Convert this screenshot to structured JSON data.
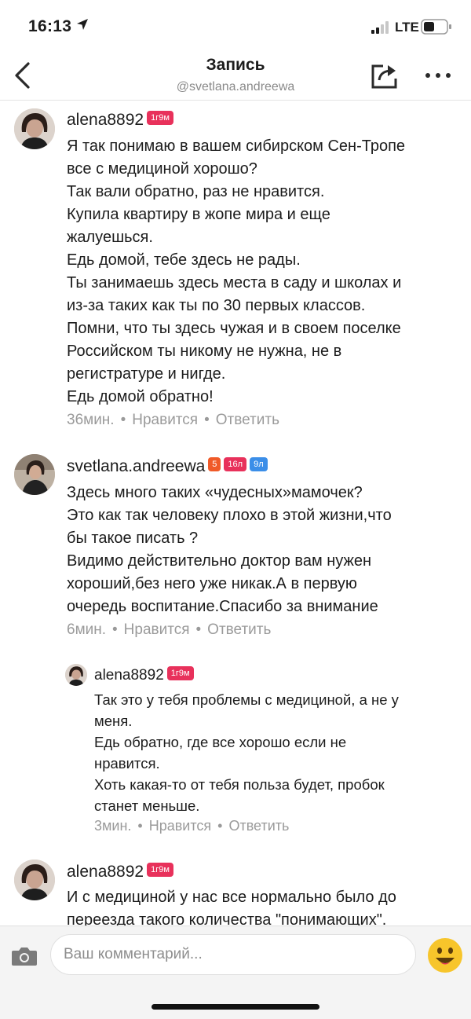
{
  "status_bar": {
    "time": "16:13",
    "network": "LTE"
  },
  "nav": {
    "title": "Запись",
    "subtitle": "@svetlana.andreewa"
  },
  "comments": [
    {
      "username": "alena8892",
      "badges": [
        "1г9м"
      ],
      "lines": [
        "Я так понимаю в вашем сибирском Сен-Тропе",
        "все с медициной хорошо?",
        "Так вали обратно, раз не нравится.",
        "Купила квартиру в жопе мира и еще",
        "жалуешься.",
        "Едь домой, тебе здесь не рады.",
        "Ты занимаешь здесь места в саду и школах и",
        "из-за таких как ты по 30 первых классов.",
        "Помни, что ты здесь чужая и в своем поселке",
        "Российском ты никому не нужна, не в",
        "регистратуре и нигде.",
        "Едь домой обратно!"
      ],
      "time": "36мин.",
      "like_label": "Нравится",
      "reply_label": "Ответить"
    },
    {
      "username": "svetlana.andreewa",
      "badges": [
        "5",
        "16л",
        "9л"
      ],
      "lines": [
        "Здесь много таких «чудесных»мамочек?",
        "Это как так человеку плохо в этой жизни,что",
        "бы такое писать ?",
        "Видимо действительно доктор вам нужен",
        "хороший,без него уже никак.А в первую",
        "очередь воспитание.Спасибо за внимание"
      ],
      "time": "6мин.",
      "like_label": "Нравится",
      "reply_label": "Ответить"
    },
    {
      "username": "alena8892",
      "badges": [
        "1г9м"
      ],
      "lines": [
        "Так это у тебя проблемы с медициной, а не у",
        "меня.",
        "Едь обратно, где все хорошо если не",
        "нравится.",
        "Хоть какая-то от тебя польза будет, пробок",
        "станет меньше."
      ],
      "time": "3мин.",
      "like_label": "Нравится",
      "reply_label": "Ответить"
    },
    {
      "username": "alena8892",
      "badges": [
        "1г9м"
      ],
      "lines": [
        "И с медициной у нас все нормально было до",
        "переезда такого количества \"понимающих\"."
      ]
    }
  ],
  "input": {
    "placeholder": "Ваш комментарий..."
  },
  "colors": {
    "badge_red": "#e8315b",
    "badge_orange": "#f05a28",
    "badge_blue": "#3b8ee8",
    "emoji_yellow": "#f7c52b"
  },
  "icons": [
    "back-chevron-icon",
    "share-icon",
    "more-icon",
    "camera-icon",
    "smiley-emoji-icon",
    "location-arrow-icon",
    "signal-icon",
    "battery-icon"
  ]
}
